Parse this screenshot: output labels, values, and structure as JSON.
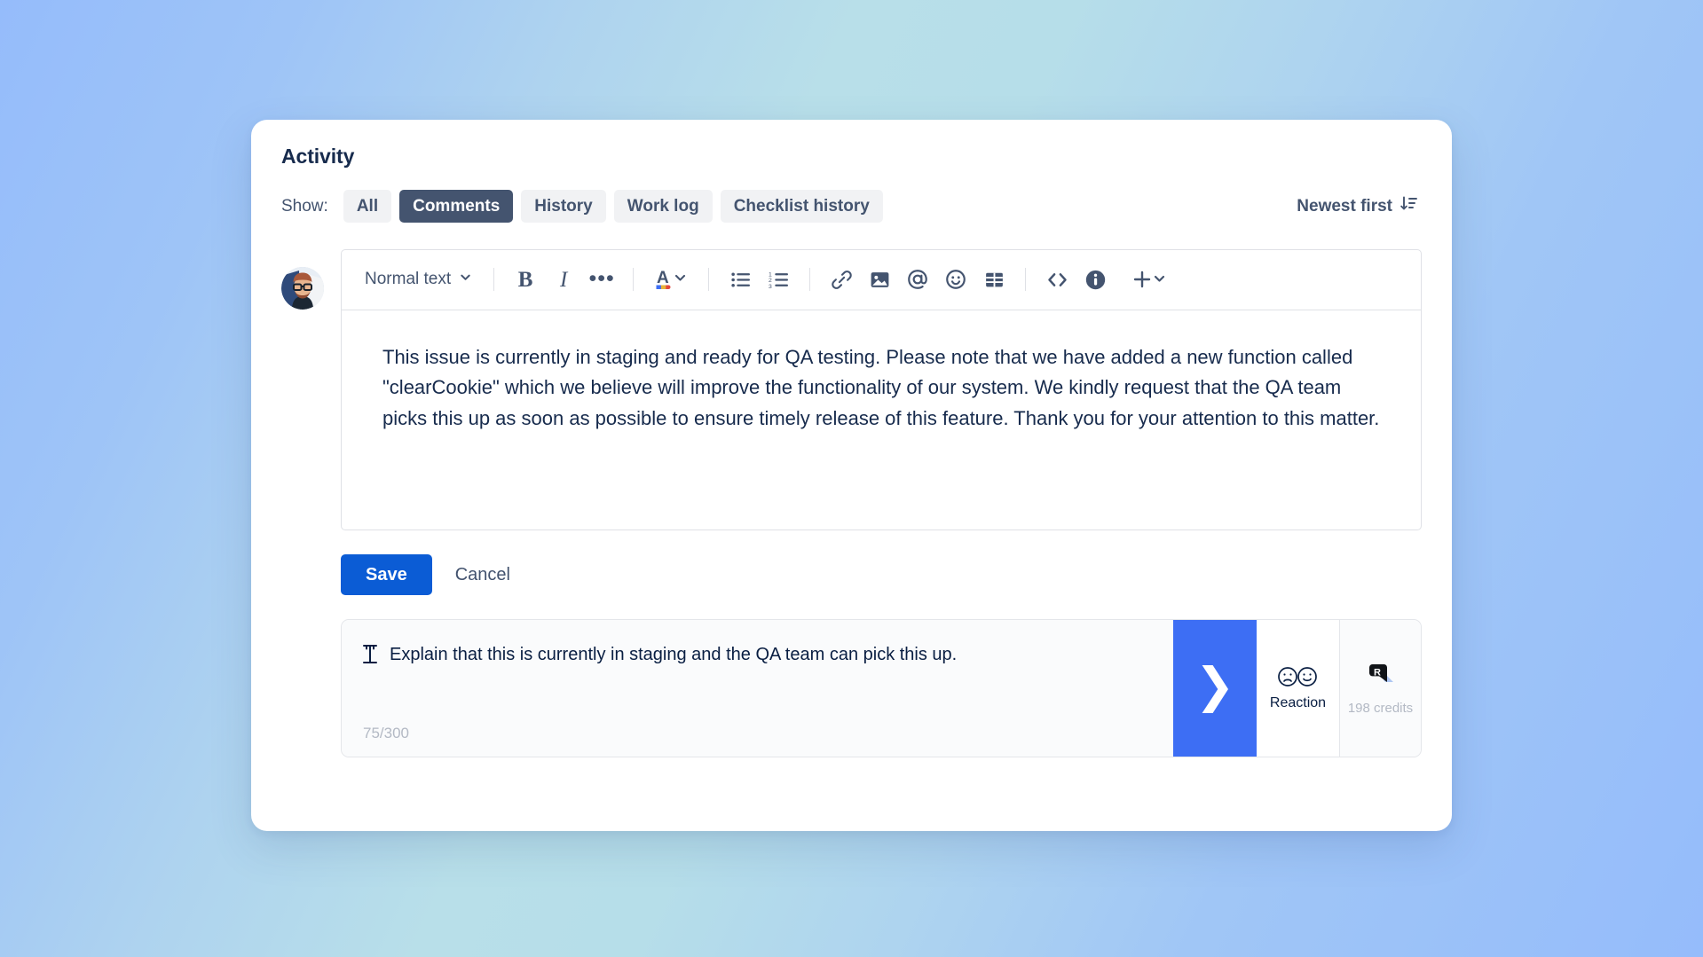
{
  "background": {
    "gradient_from": "#95bcfb",
    "gradient_mid": "#b8dfe9",
    "gradient_to": "#95bcfb"
  },
  "card": {
    "title": "Activity"
  },
  "filter": {
    "show_label": "Show:",
    "tabs": [
      {
        "label": "All",
        "active": false
      },
      {
        "label": "Comments",
        "active": true
      },
      {
        "label": "History",
        "active": false
      },
      {
        "label": "Work log",
        "active": false
      },
      {
        "label": "Checklist history",
        "active": false
      }
    ],
    "sort": {
      "label": "Newest first",
      "icon": "sort-descending-icon"
    }
  },
  "editor": {
    "avatar": {
      "icon": "user-avatar-photo",
      "alt": "User avatar"
    },
    "toolbar": {
      "text_style": "Normal text",
      "style_chevron": "chevron-down-icon",
      "bold": "B",
      "italic": "I",
      "more": "•••",
      "text_color": "A",
      "items": [
        "text-style-dropdown",
        "bold-button",
        "italic-button",
        "more-formatting-button",
        "text-color-button",
        "bullet-list-button",
        "numbered-list-button",
        "link-button",
        "image-button",
        "mention-button",
        "emoji-button",
        "table-button",
        "code-button",
        "info-panel-button",
        "insert-more-button"
      ]
    },
    "comment_body": "This issue is currently in staging and ready for QA testing. Please note that we have added a new function called \"clearCookie\" which we believe will improve the functionality of our system. We kindly request that the QA team picks this up as soon as possible to ensure timely release of this feature. Thank you for your attention to this matter."
  },
  "actions": {
    "save_label": "Save",
    "cancel_label": "Cancel",
    "save_color": "#0b5cd5"
  },
  "prompt_bar": {
    "icon": "text-cursor-icon",
    "text": "Explain that this is currently in staging and the QA team can pick this up.",
    "char_counter": "75/300",
    "submit_icon": "chevron-right-icon",
    "submit_color": "#3d6ef4",
    "reaction_label": "Reaction",
    "reaction_icon": "sad-happy-faces-icon",
    "credits_label": "198 credits",
    "credits_icon": "r-badge-icon"
  }
}
